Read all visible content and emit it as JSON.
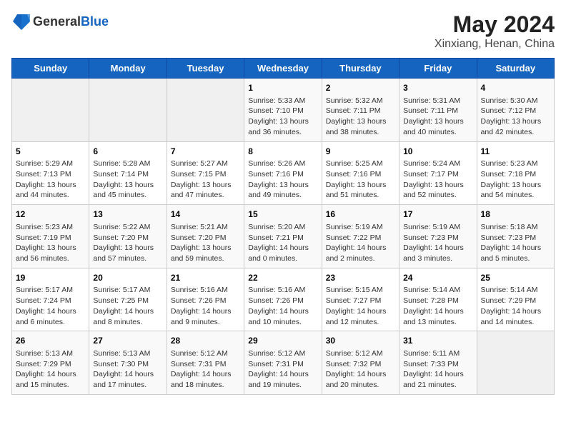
{
  "header": {
    "logo_general": "General",
    "logo_blue": "Blue",
    "title": "May 2024",
    "subtitle": "Xinxiang, Henan, China"
  },
  "days_of_week": [
    "Sunday",
    "Monday",
    "Tuesday",
    "Wednesday",
    "Thursday",
    "Friday",
    "Saturday"
  ],
  "weeks": [
    [
      {
        "day": "",
        "info": ""
      },
      {
        "day": "",
        "info": ""
      },
      {
        "day": "",
        "info": ""
      },
      {
        "day": "1",
        "info": "Sunrise: 5:33 AM\nSunset: 7:10 PM\nDaylight: 13 hours and 36 minutes."
      },
      {
        "day": "2",
        "info": "Sunrise: 5:32 AM\nSunset: 7:11 PM\nDaylight: 13 hours and 38 minutes."
      },
      {
        "day": "3",
        "info": "Sunrise: 5:31 AM\nSunset: 7:11 PM\nDaylight: 13 hours and 40 minutes."
      },
      {
        "day": "4",
        "info": "Sunrise: 5:30 AM\nSunset: 7:12 PM\nDaylight: 13 hours and 42 minutes."
      }
    ],
    [
      {
        "day": "5",
        "info": "Sunrise: 5:29 AM\nSunset: 7:13 PM\nDaylight: 13 hours and 44 minutes."
      },
      {
        "day": "6",
        "info": "Sunrise: 5:28 AM\nSunset: 7:14 PM\nDaylight: 13 hours and 45 minutes."
      },
      {
        "day": "7",
        "info": "Sunrise: 5:27 AM\nSunset: 7:15 PM\nDaylight: 13 hours and 47 minutes."
      },
      {
        "day": "8",
        "info": "Sunrise: 5:26 AM\nSunset: 7:16 PM\nDaylight: 13 hours and 49 minutes."
      },
      {
        "day": "9",
        "info": "Sunrise: 5:25 AM\nSunset: 7:16 PM\nDaylight: 13 hours and 51 minutes."
      },
      {
        "day": "10",
        "info": "Sunrise: 5:24 AM\nSunset: 7:17 PM\nDaylight: 13 hours and 52 minutes."
      },
      {
        "day": "11",
        "info": "Sunrise: 5:23 AM\nSunset: 7:18 PM\nDaylight: 13 hours and 54 minutes."
      }
    ],
    [
      {
        "day": "12",
        "info": "Sunrise: 5:23 AM\nSunset: 7:19 PM\nDaylight: 13 hours and 56 minutes."
      },
      {
        "day": "13",
        "info": "Sunrise: 5:22 AM\nSunset: 7:20 PM\nDaylight: 13 hours and 57 minutes."
      },
      {
        "day": "14",
        "info": "Sunrise: 5:21 AM\nSunset: 7:20 PM\nDaylight: 13 hours and 59 minutes."
      },
      {
        "day": "15",
        "info": "Sunrise: 5:20 AM\nSunset: 7:21 PM\nDaylight: 14 hours and 0 minutes."
      },
      {
        "day": "16",
        "info": "Sunrise: 5:19 AM\nSunset: 7:22 PM\nDaylight: 14 hours and 2 minutes."
      },
      {
        "day": "17",
        "info": "Sunrise: 5:19 AM\nSunset: 7:23 PM\nDaylight: 14 hours and 3 minutes."
      },
      {
        "day": "18",
        "info": "Sunrise: 5:18 AM\nSunset: 7:23 PM\nDaylight: 14 hours and 5 minutes."
      }
    ],
    [
      {
        "day": "19",
        "info": "Sunrise: 5:17 AM\nSunset: 7:24 PM\nDaylight: 14 hours and 6 minutes."
      },
      {
        "day": "20",
        "info": "Sunrise: 5:17 AM\nSunset: 7:25 PM\nDaylight: 14 hours and 8 minutes."
      },
      {
        "day": "21",
        "info": "Sunrise: 5:16 AM\nSunset: 7:26 PM\nDaylight: 14 hours and 9 minutes."
      },
      {
        "day": "22",
        "info": "Sunrise: 5:16 AM\nSunset: 7:26 PM\nDaylight: 14 hours and 10 minutes."
      },
      {
        "day": "23",
        "info": "Sunrise: 5:15 AM\nSunset: 7:27 PM\nDaylight: 14 hours and 12 minutes."
      },
      {
        "day": "24",
        "info": "Sunrise: 5:14 AM\nSunset: 7:28 PM\nDaylight: 14 hours and 13 minutes."
      },
      {
        "day": "25",
        "info": "Sunrise: 5:14 AM\nSunset: 7:29 PM\nDaylight: 14 hours and 14 minutes."
      }
    ],
    [
      {
        "day": "26",
        "info": "Sunrise: 5:13 AM\nSunset: 7:29 PM\nDaylight: 14 hours and 15 minutes."
      },
      {
        "day": "27",
        "info": "Sunrise: 5:13 AM\nSunset: 7:30 PM\nDaylight: 14 hours and 17 minutes."
      },
      {
        "day": "28",
        "info": "Sunrise: 5:12 AM\nSunset: 7:31 PM\nDaylight: 14 hours and 18 minutes."
      },
      {
        "day": "29",
        "info": "Sunrise: 5:12 AM\nSunset: 7:31 PM\nDaylight: 14 hours and 19 minutes."
      },
      {
        "day": "30",
        "info": "Sunrise: 5:12 AM\nSunset: 7:32 PM\nDaylight: 14 hours and 20 minutes."
      },
      {
        "day": "31",
        "info": "Sunrise: 5:11 AM\nSunset: 7:33 PM\nDaylight: 14 hours and 21 minutes."
      },
      {
        "day": "",
        "info": ""
      }
    ]
  ]
}
